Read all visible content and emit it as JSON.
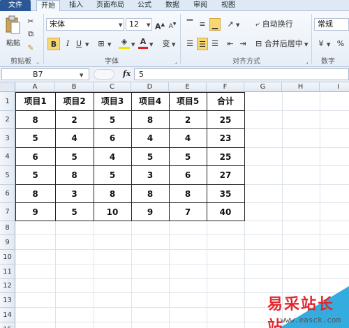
{
  "tabs": [
    {
      "label": "文件"
    },
    {
      "label": "开始"
    },
    {
      "label": "插入"
    },
    {
      "label": "页面布局"
    },
    {
      "label": "公式"
    },
    {
      "label": "数据"
    },
    {
      "label": "审阅"
    },
    {
      "label": "视图"
    }
  ],
  "ribbon": {
    "paste_label": "粘贴",
    "clipboard_label": "剪贴板",
    "font_name": "宋体",
    "font_size": "12",
    "grow_font": "A",
    "shrink_font": "A",
    "bold": "B",
    "italic": "I",
    "underline": "U",
    "font_color_glyph": "A",
    "phonetic_glyph": "变",
    "font_group_label": "字体",
    "wrap_text": "自动换行",
    "merge_center": "合并后居中",
    "align_group_label": "对齐方式",
    "number_format": "常规",
    "number_group_label": "数字"
  },
  "formula_bar": {
    "name_box": "B7",
    "fx": "fx",
    "value": "5"
  },
  "sheet": {
    "columns": [
      "A",
      "B",
      "C",
      "D",
      "E",
      "F",
      "G",
      "H",
      "I"
    ],
    "rows": [
      "1",
      "2",
      "3",
      "4",
      "5",
      "6",
      "7",
      "8",
      "9",
      "10",
      "11",
      "12",
      "13",
      "14",
      "15"
    ],
    "table": [
      [
        "项目1",
        "项目2",
        "项目3",
        "项目4",
        "项目5",
        "合计"
      ],
      [
        "8",
        "2",
        "5",
        "8",
        "2",
        "25"
      ],
      [
        "5",
        "4",
        "6",
        "4",
        "4",
        "23"
      ],
      [
        "6",
        "5",
        "4",
        "5",
        "5",
        "25"
      ],
      [
        "5",
        "8",
        "5",
        "3",
        "6",
        "27"
      ],
      [
        "8",
        "3",
        "8",
        "8",
        "8",
        "35"
      ],
      [
        "9",
        "5",
        "10",
        "9",
        "7",
        "40"
      ]
    ]
  },
  "watermark": {
    "text": "易采站长站",
    "url": "www.easck.com"
  },
  "colors": {
    "file_tab": "#2b5797",
    "highlight": "#f7d772",
    "watermark_red": "#e0292f",
    "watermark_blue": "#1fa3dd"
  }
}
